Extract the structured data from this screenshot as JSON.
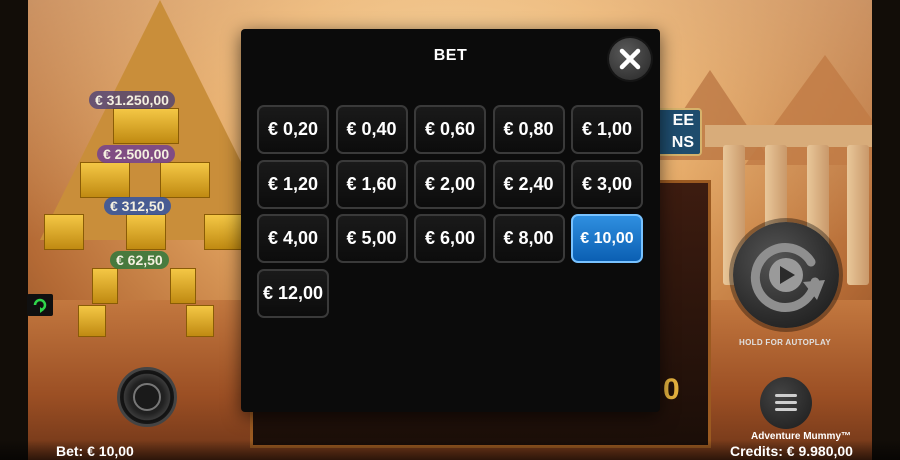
{
  "modal": {
    "title": "BET",
    "close_icon": "close-icon",
    "options": [
      "€ 0,20",
      "€ 0,40",
      "€ 0,60",
      "€ 0,80",
      "€ 1,00",
      "€ 1,20",
      "€ 1,60",
      "€ 2,00",
      "€ 2,40",
      "€ 3,00",
      "€ 4,00",
      "€ 5,00",
      "€ 6,00",
      "€ 8,00",
      "€ 10,00",
      "€ 12,00"
    ],
    "selected": "€ 10,00",
    "selected_color": "#1a78d0"
  },
  "jackpots": [
    "€ 31.250,00",
    "€ 2.500,00",
    "€ 312,50",
    "€ 62,50"
  ],
  "feature_plate": "EE\nNS",
  "autoplay_label": "HOLD FOR AUTOPLAY",
  "footer": {
    "bet": "Bet: € 10,00",
    "game_name": "Adventure Mummy™",
    "credits": "Credits: € 9.980,00"
  },
  "icons": {
    "autoplay": "autoplay-icon",
    "menu": "menu-icon",
    "chip": "chip-icon",
    "replay": "replay-icon"
  }
}
